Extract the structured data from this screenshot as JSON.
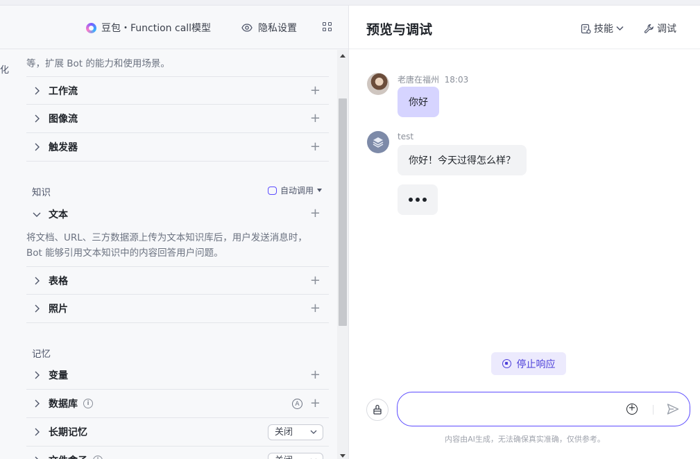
{
  "header_left": {
    "model_label": "豆包・Function call模型",
    "privacy_label": "隐私设置"
  },
  "edge_text": "化",
  "skills": {
    "intro_text": "等，扩展 Bot 的能力和使用场景。",
    "items": [
      {
        "label": "工作流"
      },
      {
        "label": "图像流"
      },
      {
        "label": "触发器"
      }
    ]
  },
  "knowledge": {
    "title": "知识",
    "auto_call_label": "自动调用",
    "text_item": "文本",
    "text_desc_line1": "将文档、URL、三方数据源上传为文本知识库后，用户发送消息时，",
    "text_desc_line2": "Bot 能够引用文本知识中的内容回答用户问题。",
    "items": [
      {
        "label": "表格"
      },
      {
        "label": "照片"
      }
    ]
  },
  "memory": {
    "title": "记忆",
    "variable": "变量",
    "database": "数据库",
    "long_term": "长期记忆",
    "long_term_value": "关闭",
    "file_box": "文件盒子",
    "file_box_value": "关闭"
  },
  "preview": {
    "title": "预览与调试",
    "skill_label": "技能",
    "debug_label": "调试",
    "user_name": "老唐在福州",
    "user_time": "18:03",
    "user_message": "你好",
    "bot_name": "test",
    "bot_message": "你好！今天过得怎么样？",
    "stop_label": "停止响应",
    "input_value": "",
    "disclaimer": "内容由AI生成，无法确保真实准确，仅供参考。"
  }
}
